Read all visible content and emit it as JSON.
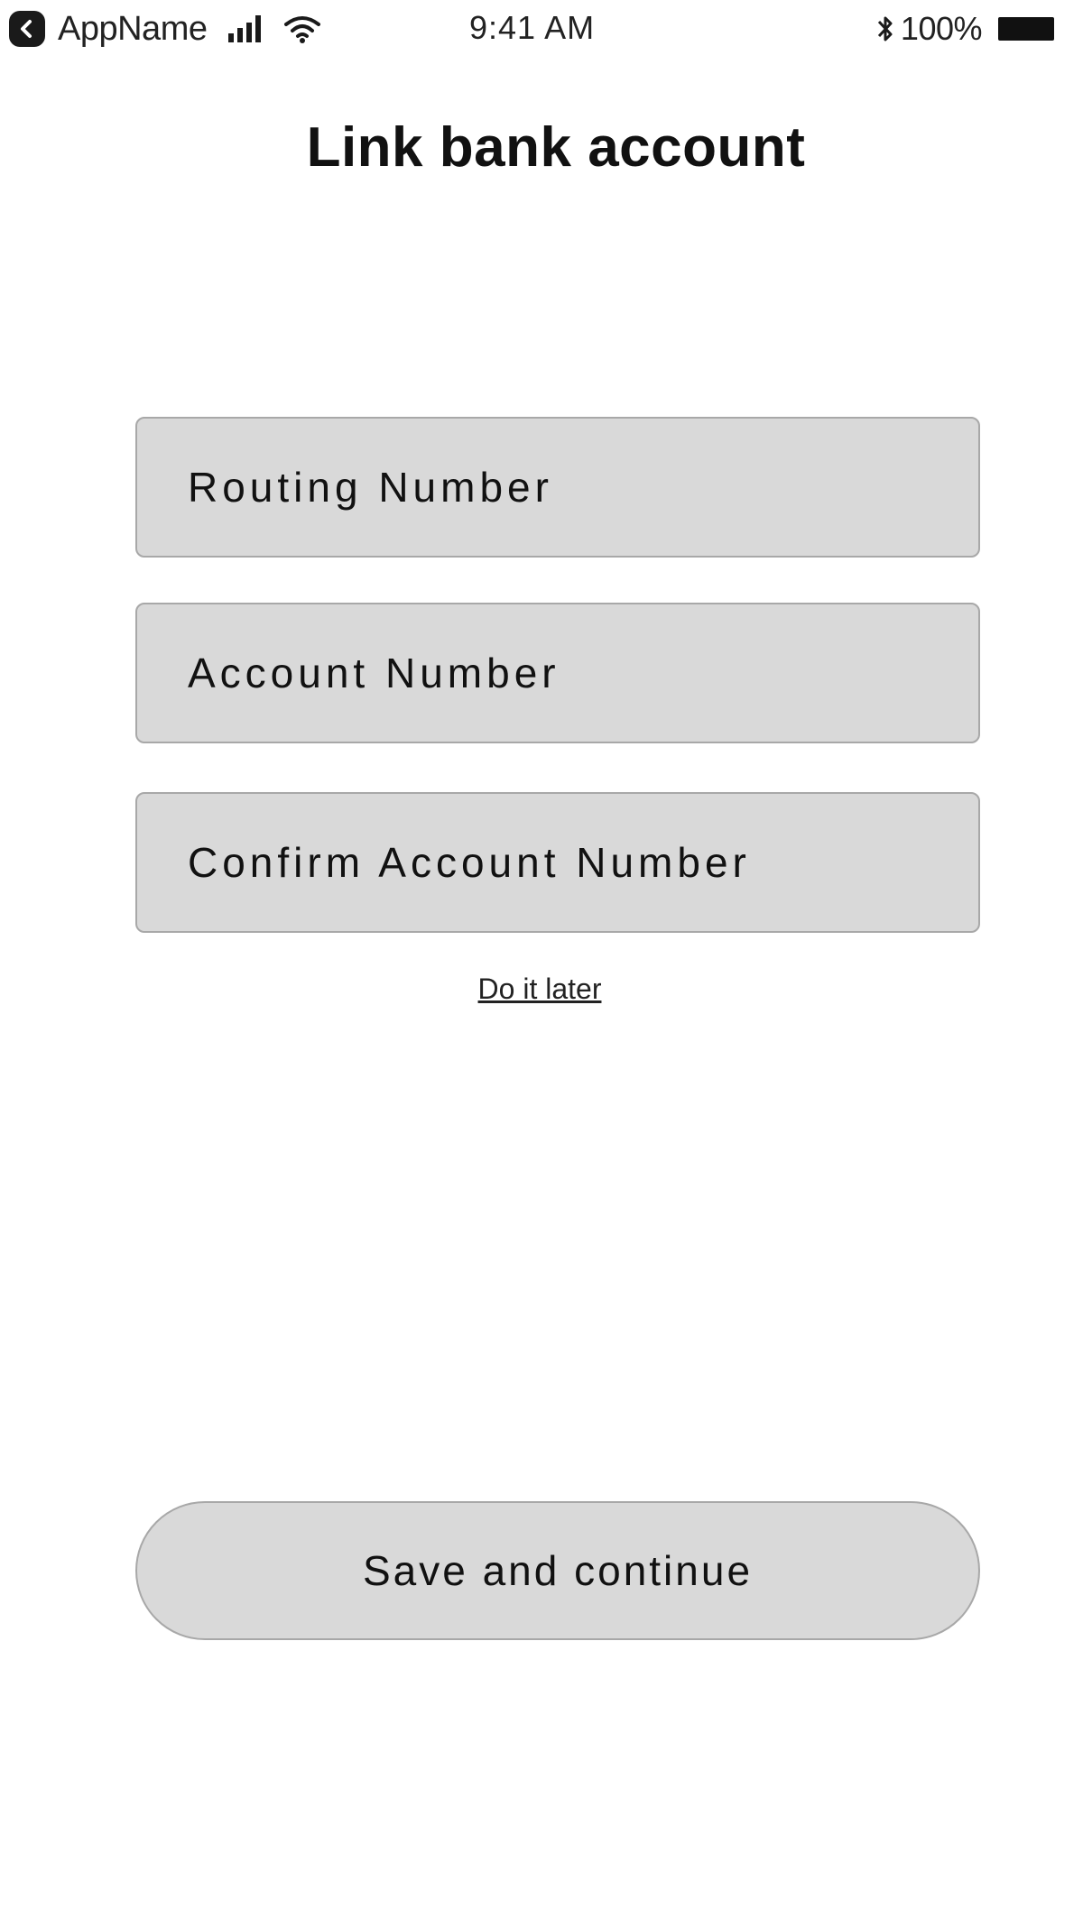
{
  "status_bar": {
    "app_name": "AppName",
    "time": "9:41 AM",
    "battery_percent": "100%",
    "icons": [
      "back-icon",
      "signal-icon",
      "wifi-icon",
      "bluetooth-icon",
      "battery-icon"
    ]
  },
  "page": {
    "title": "Link bank account"
  },
  "form": {
    "routing_placeholder": "Routing Number",
    "account_placeholder": "Account Number",
    "confirm_placeholder": "Confirm Account Number"
  },
  "actions": {
    "later_label": "Do it later",
    "save_label": "Save and continue"
  },
  "colors": {
    "field_background": "#d9d9d9",
    "field_border": "#a8a8a8",
    "text": "#111111"
  }
}
